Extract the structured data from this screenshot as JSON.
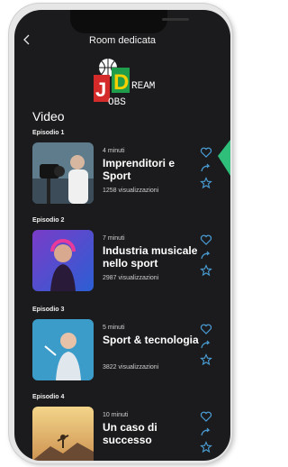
{
  "header": {
    "title": "Room dedicata",
    "back_icon": "chevron-left-icon"
  },
  "logo": {
    "letter_j": "J",
    "letter_d": "D",
    "word_ream": "REAM",
    "word_obs": "OBS"
  },
  "section": {
    "title": "Video"
  },
  "episodes": [
    {
      "label": "Episodio 1",
      "duration": "4 minuti",
      "title": "Imprenditori e Sport",
      "views": "1258 visualizzazioni"
    },
    {
      "label": "Episodio 2",
      "duration": "7 minuti",
      "title": "Industria musicale nello sport",
      "views": "2987 visualizzazioni"
    },
    {
      "label": "Episodio 3",
      "duration": "5 minuti",
      "title": "Sport & tecnologia",
      "views": "3822 visualizzazioni"
    },
    {
      "label": "Episodio 4",
      "duration": "10 minuti",
      "title": "Un caso di successo",
      "views": ""
    }
  ],
  "icons": {
    "like": "heart-icon",
    "share": "share-icon",
    "favorite": "star-icon"
  },
  "colors": {
    "background": "#1b1b1d",
    "accent": "#4a9fd8",
    "logo_red": "#d42a2a",
    "logo_green": "#1f9d4a",
    "pointer": "#2fbf7a"
  }
}
